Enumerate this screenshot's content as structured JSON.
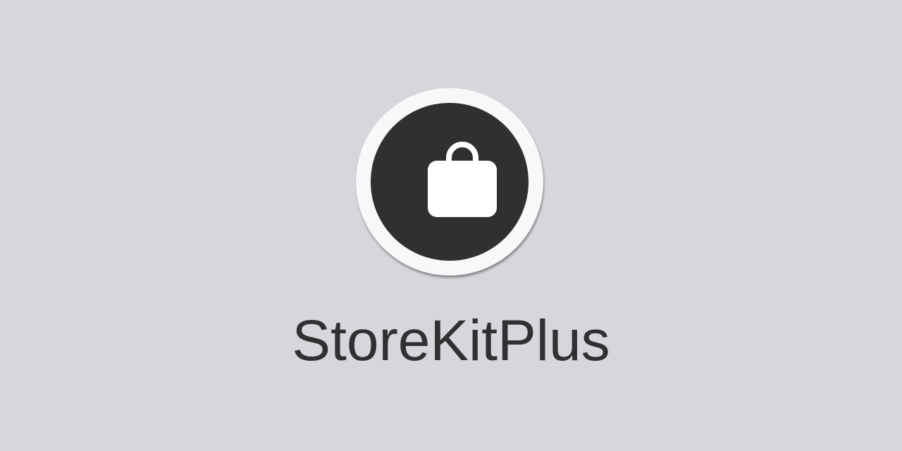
{
  "app": {
    "name": "StoreKitPlus"
  },
  "logo": {
    "icon": "shopping-bag-icon",
    "ring_color": "#f8f8f8",
    "disc_color": "#303030",
    "glyph_color": "#ffffff"
  },
  "colors": {
    "background": "#d6d7dc",
    "text": "#303030"
  }
}
